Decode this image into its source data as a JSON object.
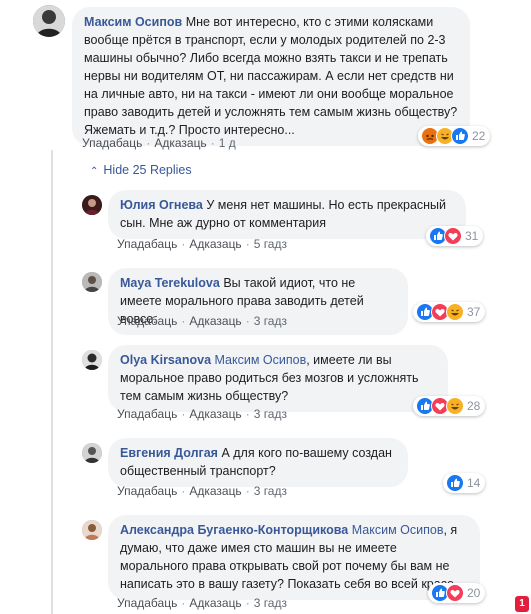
{
  "main_comment": {
    "author": "Максим Осипов",
    "text": "Мне вот интересно, кто с этими колясками вообще прётся в транспорт, если у молодых родителей по 2-3 машины обычно? Либо всегда можно взять такси и не трепать нервы ни водителям ОТ, ни пассажирам. А если нет средств ни на личные авто, ни на такси - имеют ли они вообще моральное право заводить детей и усложнять тем самым жизнь обществу? Яжемать и т.д.? Просто интересно...",
    "like_label": "Упадабаць",
    "reply_label": "Адказаць",
    "time": "1 д",
    "reaction_count": "22"
  },
  "hide_replies_label": "Hide 25 Replies",
  "replies": [
    {
      "author": "Юлия Огнева",
      "mention": "",
      "text": "У меня нет машины. Но есть прекрасный сын. Мне аж дурно от комментария",
      "like_label": "Упадабаць",
      "reply_label": "Адказаць",
      "time": "5 гадз",
      "reaction_count": "31"
    },
    {
      "author": "Maya Terekulova",
      "mention": "",
      "text": "Вы такой идиот, что не имеете морального права заводить детей вовсе.",
      "like_label": "Упадабаць",
      "reply_label": "Адказаць",
      "time": "3 гадз",
      "reaction_count": "37"
    },
    {
      "author": "Olya Kirsanova",
      "mention": "Максим Осипов",
      "text": ", имеете ли вы моральное право родиться без мозгов и усложнять тем самым жизнь обществу?",
      "like_label": "Упадабаць",
      "reply_label": "Адказаць",
      "time": "3 гадз",
      "reaction_count": "28"
    },
    {
      "author": "Евгения Долгая",
      "mention": "",
      "text": "А для кого по-вашему создан общественный транспорт?",
      "like_label": "Упадабаць",
      "reply_label": "Адказаць",
      "time": "3 гадз",
      "reaction_count": "14"
    },
    {
      "author": "Александра Бугаенко-Конторщикова",
      "mention": "Максим Осипов",
      "text": ", я думаю, что даже имея сто машин вы не имеете морального права открывать свой рот почему бы вам не написать это в вашу газету? Показать себя во всей красе",
      "like_label": "Упадабаць",
      "reply_label": "Адказаць",
      "time": "3 гадз",
      "reaction_count": "20"
    }
  ],
  "notification_count": "1",
  "colors": {
    "link": "#385898",
    "bubble": "#f2f3f5",
    "like": "#1877f2",
    "love": "#f33e58",
    "haha": "#f7b125",
    "angry": "#e9710f"
  }
}
